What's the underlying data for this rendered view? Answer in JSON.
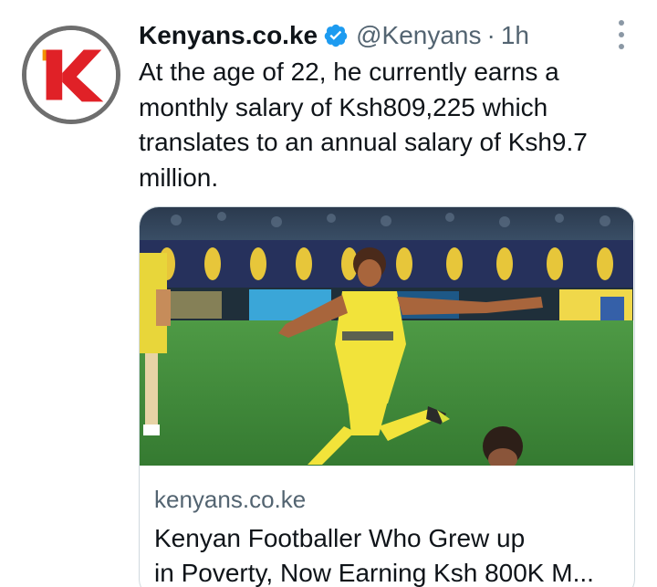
{
  "tweet": {
    "avatar_icon": "kenyans-logo",
    "display_name": "Kenyans.co.ke",
    "verified_icon": "verified-badge-icon",
    "handle": "@Kenyans",
    "separator": "·",
    "time": "1h",
    "more_icon": "more-vertical-icon",
    "text": "At the age of 22, he currently earns a monthly salary of Ksh809,225 which translates to an annual salary of Ksh9.7 million."
  },
  "card": {
    "image_icon": "footballer-photo",
    "domain": "kenyans.co.ke",
    "title_line1": "Kenyan Footballer Who Grew up",
    "title_line2": "in Poverty, Now Earning Ksh 800K M..."
  },
  "colors": {
    "verified": "#1d9bf0",
    "secondary_text": "#536471",
    "logo_red": "#e02127",
    "logo_orange": "#f39200",
    "jersey_yellow": "#f2e33a",
    "pitch_green": "#3f8a3b"
  }
}
